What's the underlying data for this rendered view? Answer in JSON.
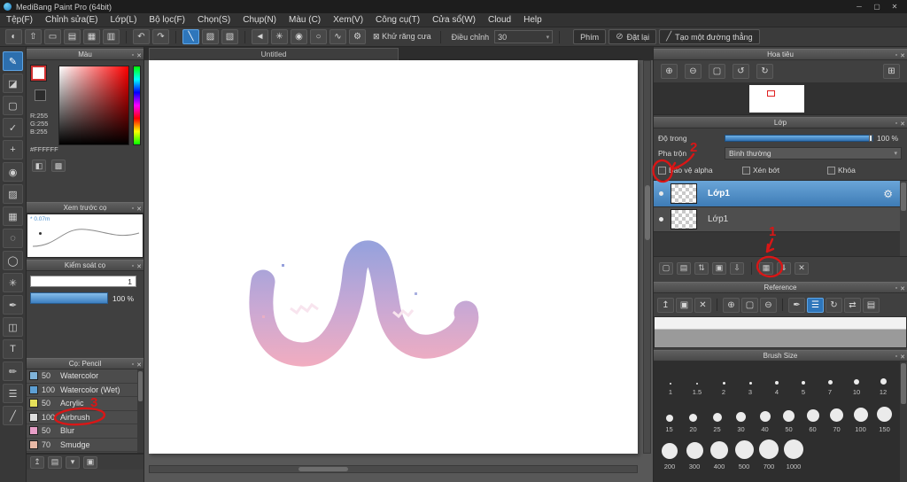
{
  "icons": {
    "popout": "▫",
    "close": "✕"
  },
  "window": {
    "title": "MediBang Paint Pro (64bit)",
    "minimize": "─",
    "maximize": "▢",
    "close": "✕"
  },
  "menu": {
    "items": [
      "Tệp(F)",
      "Chỉnh sửa(E)",
      "Lớp(L)",
      "Bộ lọc(F)",
      "Chọn(S)",
      "Chụp(N)",
      "Màu (C)",
      "Xem(V)",
      "Công cụ(T)",
      "Cửa sổ(W)",
      "Cloud",
      "Help"
    ]
  },
  "toolbar": {
    "file_icons": [
      {
        "n": "palette-icon",
        "g": "◐"
      },
      {
        "n": "export-icon",
        "g": "⇧"
      },
      {
        "n": "comment-icon",
        "g": "▭"
      },
      {
        "n": "pages-icon",
        "g": "▤"
      },
      {
        "n": "grid-icon",
        "g": "▦"
      },
      {
        "n": "layout-icon",
        "g": "▥"
      }
    ],
    "history_icons": [
      {
        "n": "undo-button",
        "g": "↶"
      },
      {
        "n": "redo-button",
        "g": "↷"
      }
    ],
    "mode_icons": [
      {
        "n": "brush-stroke-button",
        "g": "╲",
        "sel": true
      },
      {
        "n": "hatch-button",
        "g": "▨"
      },
      {
        "n": "crosshatch-button",
        "g": "▧"
      },
      {
        "sep": true
      },
      {
        "n": "snap-off-button",
        "g": "◄"
      },
      {
        "n": "snap-cross-button",
        "g": "✳"
      },
      {
        "n": "snap-circle-button",
        "g": "◉"
      },
      {
        "n": "snap-vanish-button",
        "g": "○"
      },
      {
        "n": "snap-curve-button",
        "g": "∿"
      },
      {
        "n": "snap-settings-button",
        "g": "⚙"
      }
    ],
    "antialias_icon": "⊠",
    "antialias_label": "Khử răng cưa",
    "adjust_label": "Điều chỉnh",
    "adjust_value": "30",
    "adjust_caret": "▾",
    "keys_button": "Phím",
    "reset_icon": "⊘",
    "reset_button": "Đặt lại",
    "line_icon": "╱",
    "line_button": "Tạo một đường thẳng"
  },
  "tools": [
    {
      "n": "brush-tool",
      "g": "✎",
      "sel": true
    },
    {
      "n": "eraser-tool",
      "g": "◪"
    },
    {
      "n": "select-rect-tool",
      "g": "▢"
    },
    {
      "n": "select-add-tool",
      "g": "✓"
    },
    {
      "n": "move-tool",
      "g": "+"
    },
    {
      "n": "fill-tool",
      "g": "◉"
    },
    {
      "n": "gradient-tool",
      "g": "▨"
    },
    {
      "n": "pattern-tool",
      "g": "▦"
    },
    {
      "n": "lasso-tool",
      "g": "◌"
    },
    {
      "n": "ellipse-select-tool",
      "g": "◯"
    },
    {
      "n": "magic-wand-tool",
      "g": "✳"
    },
    {
      "n": "select-pen-tool",
      "g": "✒"
    },
    {
      "n": "divide-tool",
      "g": "◫"
    },
    {
      "n": "text-tool",
      "g": "T"
    },
    {
      "n": "eyedropper-tool",
      "g": "✏"
    },
    {
      "n": "hand-tool",
      "g": "☰"
    },
    {
      "n": "slice-tool",
      "g": "╱"
    }
  ],
  "color_panel": {
    "title": "Màu",
    "r": "R:255",
    "g": "G:255",
    "b": "B:255",
    "hex": "#FFFFFF",
    "palette_icons": [
      {
        "n": "color-wheel-icon",
        "g": "◧"
      },
      {
        "n": "color-swatches-icon",
        "g": "▩"
      }
    ]
  },
  "preview_panel": {
    "title": "Xem trước cọ",
    "note": "* 0.07m"
  },
  "control_panel": {
    "title": "Kiểm soát cọ",
    "width_value": "1",
    "opacity_value": "100 %"
  },
  "brush_panel": {
    "title": "Cọ: Pencil",
    "brushes": [
      {
        "size": "50",
        "name": "Watercolor",
        "color": "#7fb3d9"
      },
      {
        "size": "100",
        "name": "Watercolor (Wet)",
        "color": "#5d9fd3"
      },
      {
        "size": "50",
        "name": "Acrylic",
        "color": "#e6e05a"
      },
      {
        "size": "100",
        "name": "Airbrush",
        "color": "#dcdcdc"
      },
      {
        "size": "50",
        "name": "Blur",
        "color": "#e79ec7"
      },
      {
        "size": "70",
        "name": "Smudge",
        "color": "#e8b9a6"
      }
    ],
    "footer_icons": [
      {
        "n": "brush-up-icon",
        "g": "↥"
      },
      {
        "n": "new-brush-icon",
        "g": "▤"
      },
      {
        "n": "brush-menu-icon",
        "g": "▾"
      },
      {
        "n": "brush-folder-icon",
        "g": "▣"
      }
    ]
  },
  "canvas": {
    "tab": "Untitled"
  },
  "navigator": {
    "title": "Hoa tiêu",
    "toolbar": [
      {
        "n": "zoom-in-icon",
        "g": "⊕"
      },
      {
        "n": "zoom-out-icon",
        "g": "⊖"
      },
      {
        "n": "fit-view-icon",
        "g": "▢"
      },
      {
        "n": "rotate-left-icon",
        "g": "↺"
      },
      {
        "n": "rotate-right-icon",
        "g": "↻"
      },
      {
        "n": "nav-settings-icon",
        "g": "⊞"
      }
    ]
  },
  "layer_panel": {
    "title": "Lớp",
    "opacity_label": "Độ trong",
    "opacity_value": "100 %",
    "blend_label": "Pha trộn",
    "blend_value": "Bình thường",
    "blend_caret": "▾",
    "checks": [
      "Bảo vệ alpha",
      "Xén bớt",
      "Khóa"
    ],
    "layers": [
      {
        "name": "Lớp1"
      },
      {
        "name": "Lớp1"
      }
    ],
    "gear_icon": "⚙",
    "buttons": [
      {
        "n": "new-layer-button",
        "g": "▢"
      },
      {
        "n": "new-halftone-layer-button",
        "g": "▤"
      },
      {
        "n": "layer-order-button",
        "g": "⇅"
      },
      {
        "n": "layer-folder-button",
        "g": "▣"
      },
      {
        "n": "layer-transfer-button",
        "g": "⇩"
      },
      {
        "sep": true
      },
      {
        "n": "duplicate-layer-button",
        "g": "▦"
      },
      {
        "n": "merge-layer-button",
        "g": "⇓"
      },
      {
        "n": "delete-layer-button",
        "g": "✕"
      }
    ]
  },
  "reference": {
    "title": "Reference",
    "toolbar": [
      {
        "n": "ref-import-icon",
        "g": "↥"
      },
      {
        "n": "ref-folder-icon",
        "g": "▣"
      },
      {
        "n": "ref-clear-icon",
        "g": "✕"
      },
      {
        "sep": true
      },
      {
        "n": "ref-zoom-in-icon",
        "g": "⊕"
      },
      {
        "n": "ref-fit-icon",
        "g": "▢"
      },
      {
        "n": "ref-zoom-out-icon",
        "g": "⊖"
      },
      {
        "sep": true
      },
      {
        "n": "ref-eyedropper-icon",
        "g": "✒"
      },
      {
        "n": "ref-hand-icon",
        "g": "☰",
        "sel": true
      },
      {
        "n": "ref-rotate-icon",
        "g": "↻"
      },
      {
        "n": "ref-flip-icon",
        "g": "⇄"
      },
      {
        "n": "ref-clip-icon",
        "g": "▤"
      }
    ]
  },
  "brush_size": {
    "title": "Brush Size",
    "rows": [
      {
        "labels": [
          "1",
          "1.5",
          "2",
          "3",
          "4",
          "5",
          "7",
          "10",
          "12"
        ],
        "dots": [
          2,
          2,
          3,
          3,
          4,
          4,
          5,
          6,
          7
        ]
      },
      {
        "labels": [
          "15",
          "20",
          "25",
          "30",
          "40",
          "50",
          "60",
          "70",
          "100",
          "150"
        ],
        "dots": [
          8,
          9,
          10,
          11,
          12,
          13,
          14,
          15,
          16,
          17
        ]
      },
      {
        "labels": [
          "200",
          "300",
          "400",
          "500",
          "700",
          "1000"
        ],
        "dots": [
          18,
          19,
          20,
          21,
          22,
          22
        ]
      }
    ]
  },
  "annotations": {
    "one": "1",
    "two": "2",
    "three": "3"
  }
}
